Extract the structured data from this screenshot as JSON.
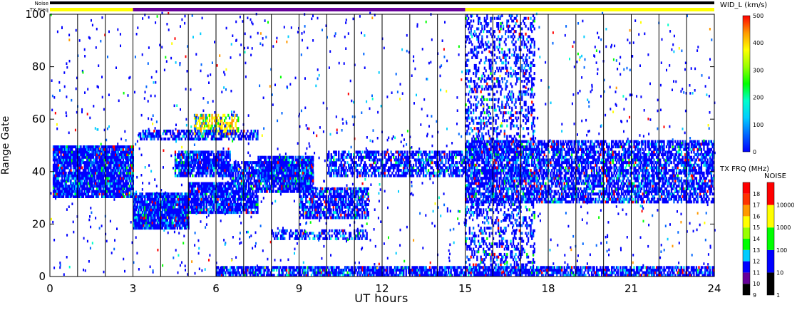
{
  "chart_data": {
    "type": "heatmap",
    "xlabel": "UT hours",
    "ylabel": "Range Gate",
    "xlim": [
      0,
      24
    ],
    "ylim": [
      0,
      100
    ],
    "x_ticks": [
      "0",
      "3",
      "6",
      "9",
      "12",
      "15",
      "18",
      "21",
      "24"
    ],
    "y_ticks": [
      "0",
      "20",
      "40",
      "60",
      "80",
      "100"
    ],
    "vertical_lines_ut": [
      1,
      2,
      3,
      4,
      5,
      6,
      7,
      8,
      9,
      10,
      11,
      12,
      13,
      14,
      15,
      16,
      17,
      18,
      19,
      20,
      21,
      22,
      23
    ],
    "noise_strip_label": "Noise",
    "txfreq_strip_label": "TX Freq",
    "txfreq_strip": [
      {
        "start": 0,
        "end": 3,
        "color": "#ffff00"
      },
      {
        "start": 3,
        "end": 15,
        "color": "#660099"
      },
      {
        "start": 15,
        "end": 24,
        "color": "#ffff00"
      }
    ],
    "regions": [
      {
        "ut": [
          0.1,
          3.0
        ],
        "gate": [
          30,
          50
        ],
        "value": "low",
        "density": 0.9
      },
      {
        "ut": [
          3.0,
          5.0
        ],
        "gate": [
          18,
          32
        ],
        "value": "low",
        "density": 0.95
      },
      {
        "ut": [
          5.0,
          7.5
        ],
        "gate": [
          24,
          36
        ],
        "value": "low",
        "density": 0.85
      },
      {
        "ut": [
          7.5,
          9.5
        ],
        "gate": [
          32,
          46
        ],
        "value": "low",
        "density": 0.85
      },
      {
        "ut": [
          4.5,
          6.5
        ],
        "gate": [
          38,
          48
        ],
        "value": "low",
        "density": 0.8
      },
      {
        "ut": [
          6.5,
          9.5
        ],
        "gate": [
          36,
          44
        ],
        "value": "low",
        "density": 0.7
      },
      {
        "ut": [
          9.0,
          11.5
        ],
        "gate": [
          22,
          34
        ],
        "value": "low",
        "density": 0.7
      },
      {
        "ut": [
          10.0,
          15.0
        ],
        "gate": [
          38,
          48
        ],
        "value": "low",
        "density": 0.6
      },
      {
        "ut": [
          5.2,
          6.8
        ],
        "gate": [
          54,
          62
        ],
        "value": "high",
        "density": 0.6
      },
      {
        "ut": [
          15.0,
          24.0
        ],
        "gate": [
          28,
          52
        ],
        "value": "low",
        "density": 0.65
      },
      {
        "ut": [
          15.0,
          17.5
        ],
        "gate": [
          0,
          100
        ],
        "value": "low",
        "density": 0.3
      },
      {
        "ut": [
          6.0,
          24.0
        ],
        "gate": [
          0,
          4
        ],
        "value": "low",
        "density": 0.75
      },
      {
        "ut": [
          3.2,
          7.5
        ],
        "gate": [
          52,
          56
        ],
        "value": "low",
        "density": 0.6
      },
      {
        "ut": [
          8.0,
          11.5
        ],
        "gate": [
          14,
          18
        ],
        "value": "low",
        "density": 0.5
      }
    ],
    "colorbars": [
      {
        "title": "WID_L (km/s)",
        "type": "continuous",
        "range": [
          0,
          500
        ],
        "tick_labels": [
          "0",
          "100",
          "200",
          "300",
          "400",
          "500"
        ],
        "colors": [
          "#0000ff",
          "#0066ff",
          "#00ccff",
          "#00ffcc",
          "#00ff00",
          "#99ff00",
          "#ffff00",
          "#ff9900",
          "#ff0000"
        ]
      },
      {
        "title": "TX FRQ (MHz)",
        "type": "discrete",
        "tick_labels": [
          "9",
          "10",
          "11",
          "12",
          "13",
          "14",
          "15",
          "16",
          "17",
          "18"
        ],
        "colors": [
          "#000000",
          "#660099",
          "#0000ff",
          "#00ccff",
          "#00ff00",
          "#99ff00",
          "#ffff00",
          "#ff9900",
          "#ff3300",
          "#ff0000"
        ]
      },
      {
        "title": "NOISE",
        "type": "discrete",
        "tick_labels": [
          "1",
          "10",
          "100",
          "1000",
          "10000"
        ],
        "colors": [
          "#000000",
          "#0000ff",
          "#00ff00",
          "#ffff00",
          "#ff0000"
        ]
      }
    ]
  }
}
